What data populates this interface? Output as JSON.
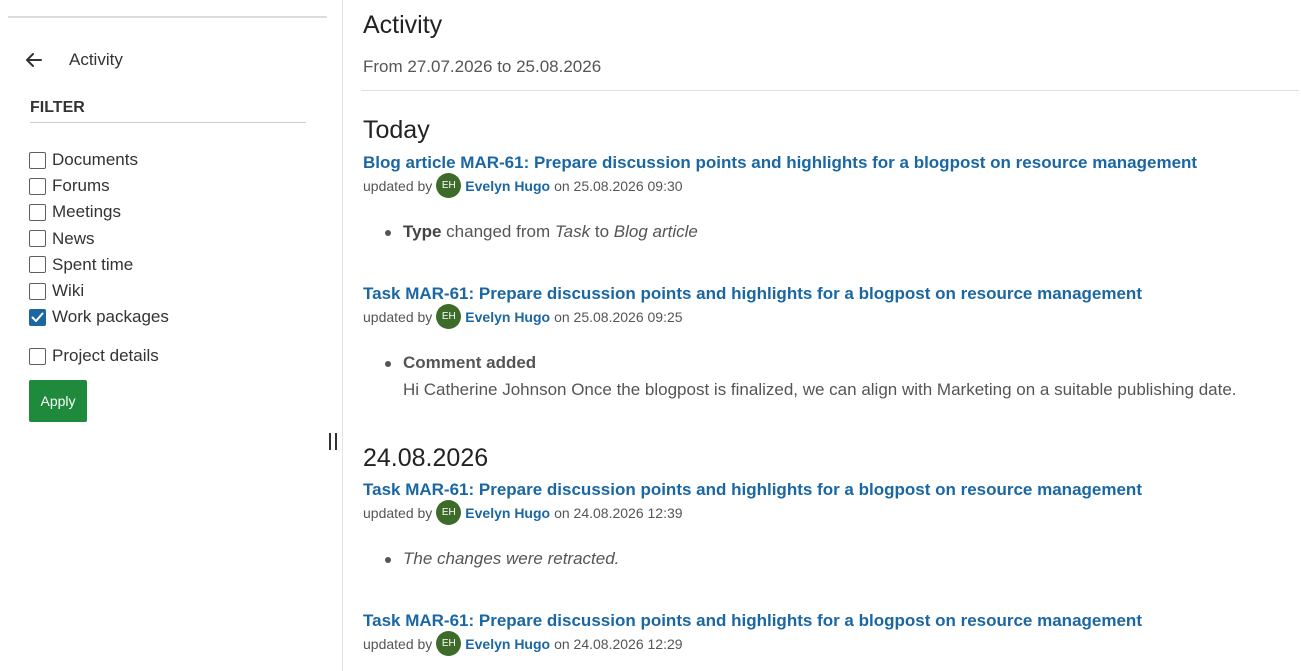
{
  "sidebar": {
    "title": "Activity",
    "filter_heading": "FILTER",
    "filters": [
      {
        "label": "Documents",
        "checked": false
      },
      {
        "label": "Forums",
        "checked": false
      },
      {
        "label": "Meetings",
        "checked": false
      },
      {
        "label": "News",
        "checked": false
      },
      {
        "label": "Spent time",
        "checked": false
      },
      {
        "label": "Wiki",
        "checked": false
      },
      {
        "label": "Work packages",
        "checked": true
      },
      {
        "label": "Project details",
        "checked": false
      }
    ],
    "apply_label": "Apply"
  },
  "main": {
    "title": "Activity",
    "date_range": "From 27.07.2026 to 25.08.2026",
    "days": [
      {
        "heading": "Today",
        "entries": [
          {
            "title": "Blog article MAR-61: Prepare discussion points and highlights for a blogpost on resource management",
            "updated_by": "updated by",
            "avatar_initials": "EH",
            "author": "Evelyn Hugo",
            "timestamp": "on 25.08.2026 09:30",
            "detail": {
              "field": "Type",
              "changed_from": "changed from",
              "old": "Task",
              "to": "to",
              "new": "Blog article"
            }
          },
          {
            "title": "Task MAR-61: Prepare discussion points and highlights for a blogpost on resource management",
            "updated_by": "updated by",
            "avatar_initials": "EH",
            "author": "Evelyn Hugo",
            "timestamp": "on 25.08.2026 09:25",
            "detail": {
              "label": "Comment added",
              "comment": "Hi Catherine Johnson Once the blogpost is finalized, we can align with Marketing on a suitable publishing date."
            }
          }
        ]
      },
      {
        "heading": "24.08.2026",
        "entries": [
          {
            "title": "Task MAR-61: Prepare discussion points and highlights for a blogpost on resource management",
            "updated_by": "updated by",
            "avatar_initials": "EH",
            "author": "Evelyn Hugo",
            "timestamp": "on 24.08.2026 12:39",
            "detail": {
              "text": "The changes were retracted."
            }
          },
          {
            "title": "Task MAR-61: Prepare discussion points and highlights for a blogpost on resource management",
            "updated_by": "updated by",
            "avatar_initials": "EH",
            "author": "Evelyn Hugo",
            "timestamp": "on 24.08.2026 12:29"
          }
        ]
      }
    ]
  },
  "colors": {
    "link": "#1a67a3",
    "apply_button": "#1f8a3b",
    "avatar": "#3c6b2a",
    "checkbox_checked": "#1a67a3"
  },
  "icons": {
    "back": "arrow-left-icon",
    "check": "checkmark-icon",
    "resize": "drag-handle-icon"
  }
}
